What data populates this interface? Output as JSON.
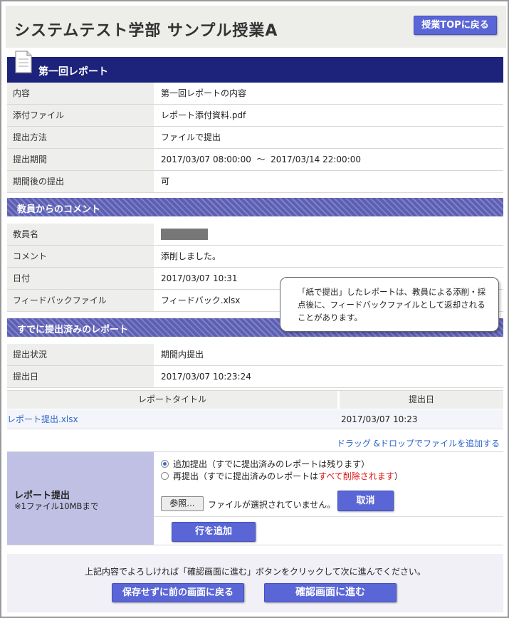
{
  "header": {
    "title": "システムテスト学部  サンプル授業A",
    "top_button": "授業TOPに戻る"
  },
  "report": {
    "section_title": "第一回レポート",
    "rows": [
      {
        "label": "内容",
        "value": "第一回レポートの内容"
      },
      {
        "label": "添付ファイル",
        "value": "レポート添付資料.pdf"
      },
      {
        "label": "提出方法",
        "value": "ファイルで提出"
      },
      {
        "label": "提出期間",
        "value": "2017/03/07 08:00:00  〜  2017/03/14 22:00:00"
      },
      {
        "label": "期間後の提出",
        "value": "可"
      }
    ]
  },
  "comment": {
    "section_title": "教員からのコメント",
    "rows": [
      {
        "label": "教員名",
        "value": ""
      },
      {
        "label": "コメント",
        "value": "添削しました。"
      },
      {
        "label": "日付",
        "value": "2017/03/07 10:31"
      },
      {
        "label": "フィードバックファイル",
        "value": "フィードバック.xlsx"
      }
    ]
  },
  "callout": {
    "text": "「紙で提出」したレポートは、教員による添削・採点後に、フィードバックファイルとして返却されることがあります。"
  },
  "submitted": {
    "section_title": "すでに提出済みのレポート",
    "rows": [
      {
        "label": "提出状況",
        "value": "期間内提出"
      },
      {
        "label": "提出日",
        "value": "2017/03/07 10:23:24"
      }
    ],
    "table": {
      "headers": [
        "レポートタイトル",
        "提出日"
      ],
      "rows": [
        {
          "title": "レポート提出.xlsx",
          "date": "2017/03/07 10:23"
        }
      ]
    },
    "dnd_link": "ドラッグ &ドロップでファイルを追加する"
  },
  "upload": {
    "label": "レポート提出",
    "note": "※1ファイル10MBまで",
    "options": [
      {
        "text": "追加提出（すでに提出済みのレポートは残ります）",
        "selected": true
      },
      {
        "text": "再提出（すでに提出済みのレポートは",
        "warning": "すべて削除されます",
        "suffix": "）",
        "selected": false
      }
    ],
    "browse_button": "参照...",
    "no_file_text": "ファイルが選択されていません。",
    "clear_button": "取消",
    "add_row_button": "行を追加"
  },
  "footer": {
    "instruction": "上記内容でよろしければ「確認画面に進む」ボタンをクリックして次に進んでください。",
    "back_button": "保存せずに前の画面に戻る",
    "confirm_button": "確認画面に進む"
  },
  "colors": {
    "accent": "#5a66d6",
    "report_header": "#1d237a",
    "section_bar": "#5c5fb4",
    "link": "#2d64c8",
    "warning": "#e01010"
  },
  "icons": [
    "document-icon"
  ]
}
